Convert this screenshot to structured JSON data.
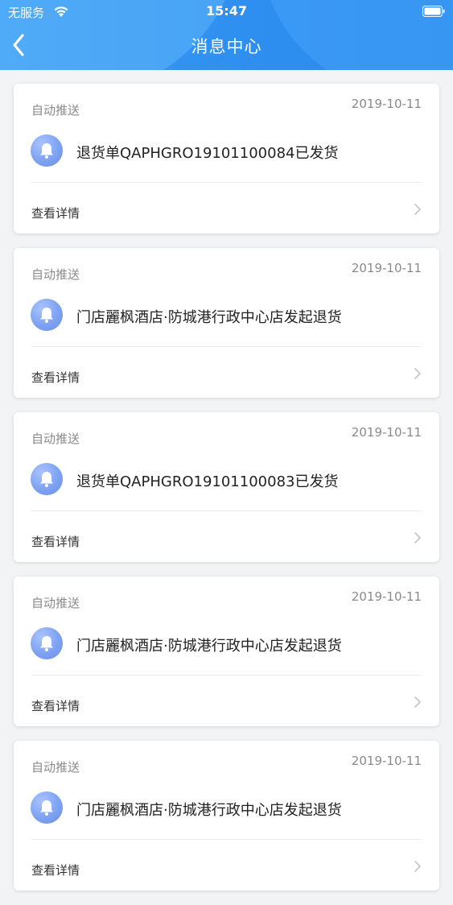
{
  "status_bar": {
    "carrier": "无服务",
    "time": "15:47"
  },
  "nav": {
    "title": "消息中心"
  },
  "messages": [
    {
      "type": "自动推送",
      "date": "2019-10-11",
      "text": "退货单QAPHGRO19101100084已发货",
      "detail_label": "查看详情"
    },
    {
      "type": "自动推送",
      "date": "2019-10-11",
      "text": "门店麗枫酒店·防城港行政中心店发起退货",
      "detail_label": "查看详情"
    },
    {
      "type": "自动推送",
      "date": "2019-10-11",
      "text": "退货单QAPHGRO19101100083已发货",
      "detail_label": "查看详情"
    },
    {
      "type": "自动推送",
      "date": "2019-10-11",
      "text": "门店麗枫酒店·防城港行政中心店发起退货",
      "detail_label": "查看详情"
    },
    {
      "type": "自动推送",
      "date": "2019-10-11",
      "text": "门店麗枫酒店·防城港行政中心店发起退货",
      "detail_label": "查看详情"
    }
  ],
  "colors": {
    "header": "#2e8ff0",
    "bell": "#7ea2f2",
    "background": "#f2f3f5"
  }
}
